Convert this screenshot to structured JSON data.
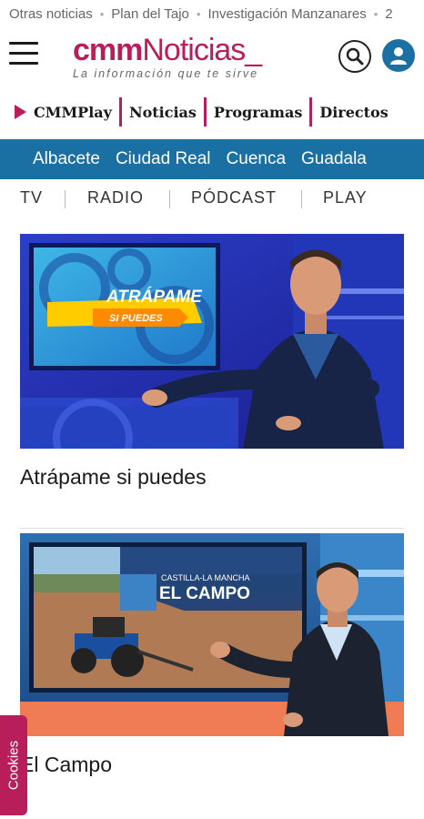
{
  "trending": {
    "items": [
      "Otras noticias",
      "Plan del Tajo",
      "Investigación Manzanares",
      "2"
    ],
    "separator": "•"
  },
  "header": {
    "logo_cmm": "cmm",
    "logo_noticias": "Noticias_",
    "tagline": "La información que te sirve",
    "menu_icon": "hamburger-menu-icon",
    "search_icon": "search-icon",
    "user_icon": "user-icon"
  },
  "mainnav": {
    "items": [
      "CMMPlay",
      "Noticias",
      "Programas",
      "Directos"
    ]
  },
  "provinces": {
    "items": [
      "Albacete",
      "Ciudad Real",
      "Cuenca",
      "Guadala"
    ]
  },
  "mediatabs": {
    "items": [
      "TV",
      "RADIO",
      "PÓDCAST",
      "PLAY"
    ]
  },
  "cards": [
    {
      "title": "Atrápame si puedes",
      "screen_line1": "ATRÁPAME",
      "screen_line2": "SI PUEDES"
    },
    {
      "title": "El Campo",
      "screen_line1": "CASTILLA-LA MANCHA",
      "screen_line2": "EL CAMPO"
    }
  ],
  "cookies": {
    "label": "Cookies"
  },
  "colors": {
    "brand": "#b81e5a",
    "blue": "#1a6fa3"
  }
}
